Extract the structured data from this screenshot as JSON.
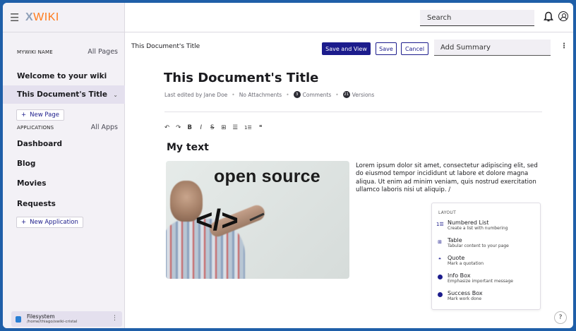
{
  "app": {
    "logo_mark": "X",
    "logo_word": "WIKI"
  },
  "sidebar": {
    "wiki_name_label": "MYWIKI NAME",
    "all_pages_link": "All Pages",
    "pages": [
      {
        "label": "Welcome to your wiki"
      },
      {
        "label": "This Document's Title",
        "active": true
      }
    ],
    "new_page_button": "New Page",
    "applications_label": "APPLICATIONS",
    "all_apps_link": "All Apps",
    "apps": [
      {
        "label": "Dashboard"
      },
      {
        "label": "Blog"
      },
      {
        "label": "Movies"
      },
      {
        "label": "Requests"
      }
    ],
    "new_application_button": "New Application",
    "filesystem": {
      "title": "Filesystem",
      "path": "/home/thiago/xwiki-cristal"
    }
  },
  "topbar": {
    "search_placeholder": "Search",
    "icons": [
      "bell-icon",
      "account-icon"
    ]
  },
  "editbar": {
    "doc_title": "This Document's Title",
    "save_and_view": "Save and View",
    "save": "Save",
    "cancel": "Cancel",
    "summary_placeholder": "Add Summary"
  },
  "document": {
    "title": "This Document's Title",
    "meta": {
      "last_edited": "Last edited by Jane Doe",
      "attachments": "No Attachments",
      "comments_count": "3",
      "comments_label": "Comments",
      "versions_count": "21",
      "versions_label": "Versions"
    },
    "heading": "My text",
    "image_text": {
      "headline": "open source",
      "code": "</>"
    },
    "paragraph": "Lorem ipsum dolor sit amet, consectetur adipiscing elit, sed do eiusmod tempor incididunt ut labore et dolore magna aliqua. Ut enim ad minim veniam, quis nostrud exercitation ullamco laboris nisi ut aliquip. /"
  },
  "toolbar": {
    "undo": "↶",
    "redo": "↷",
    "bold": "B",
    "italic": "I",
    "strike": "S",
    "table": "⊞",
    "bullet_list": "☰",
    "numbered_list": "1☰",
    "quote": "❝"
  },
  "layout_menu": {
    "header": "LAYOUT",
    "options": [
      {
        "name": "Numbered List",
        "desc": "Create a list with numbering",
        "icon": "numbered-list-icon"
      },
      {
        "name": "Table",
        "desc": "Tabular content to your page",
        "icon": "table-icon"
      },
      {
        "name": "Quote",
        "desc": "Mark a quotation",
        "icon": "quote-icon"
      },
      {
        "name": "Info Box",
        "desc": "Emphasize important message",
        "icon": "info-icon"
      },
      {
        "name": "Success Box",
        "desc": "Mark work done",
        "icon": "check-circle-icon"
      }
    ]
  },
  "help": {
    "label": "?"
  },
  "colors": {
    "primary": "#1c1c8c",
    "sidebar_bg": "#f3f1f6",
    "logo_accent": "#ff7a1a",
    "frame": "#1f5fa8"
  }
}
